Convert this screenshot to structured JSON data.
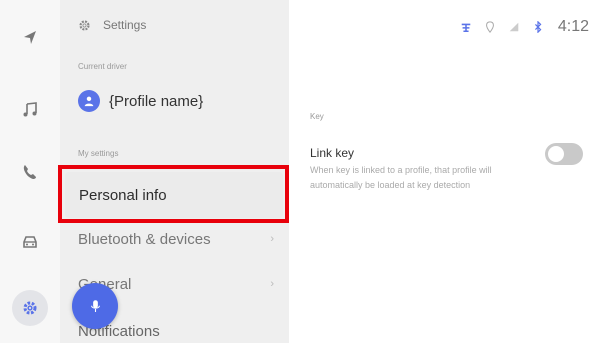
{
  "rail": {
    "items": [
      {
        "icon": "navigation-arrow-icon"
      },
      {
        "icon": "music-note-icon"
      },
      {
        "icon": "phone-icon"
      },
      {
        "icon": "car-icon"
      },
      {
        "icon": "gear-icon",
        "active": true
      }
    ]
  },
  "settings": {
    "title": "Settings",
    "current_driver_label": "Current driver",
    "profile_name": "{Profile name}",
    "my_settings_label": "My settings",
    "items": [
      {
        "label": "Personal info",
        "highlighted": true
      },
      {
        "label": "Bluetooth & devices"
      },
      {
        "label": "General"
      },
      {
        "label": "Notifications"
      }
    ]
  },
  "status_bar": {
    "icons": [
      "connectivity-icon",
      "location-icon",
      "signal-icon",
      "bluetooth-icon"
    ],
    "time": "4:12"
  },
  "key_section": {
    "label": "Key",
    "link_key": {
      "title": "Link key",
      "description": "When key is linked to a profile, that profile will automatically be loaded at key detection",
      "enabled": false
    }
  },
  "colors": {
    "accent": "#5a73e8",
    "highlight": "#e8000b",
    "panel_bg": "#efefef",
    "rail_bg": "#f7f7f7"
  }
}
